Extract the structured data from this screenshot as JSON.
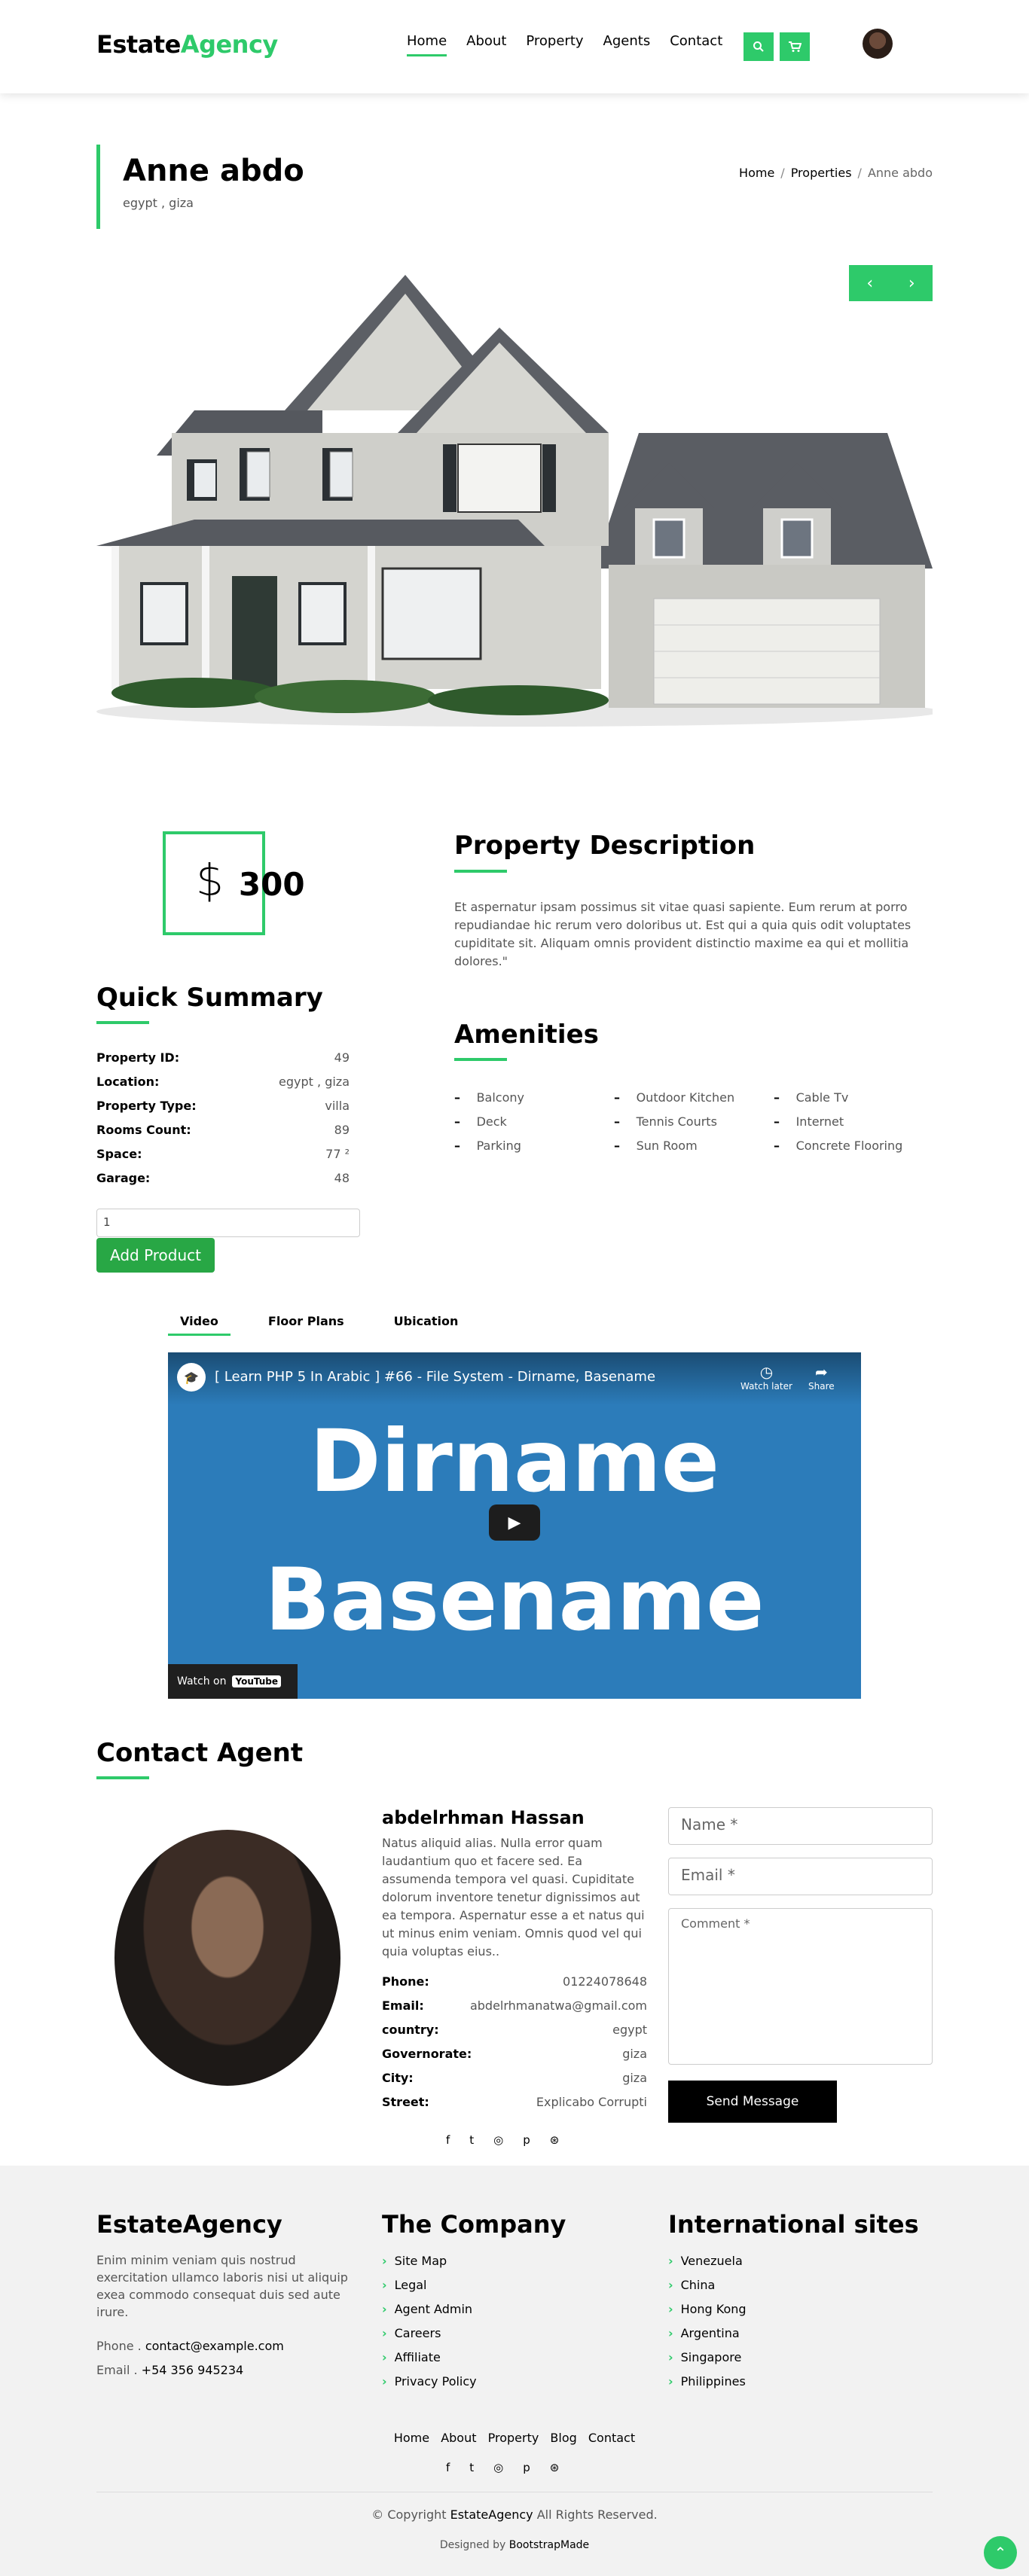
{
  "brand": {
    "part1": "Estate",
    "part2": "Agency"
  },
  "nav": {
    "links": [
      "Home",
      "About",
      "Property",
      "Agents",
      "Contact"
    ]
  },
  "header": {
    "title": "Anne abdo",
    "subtitle": "egypt , giza"
  },
  "breadcrumb": {
    "items": [
      "Home",
      "Properties",
      "Anne abdo"
    ]
  },
  "carousel": {
    "prev": "‹",
    "next": "›"
  },
  "price": {
    "currency": "$",
    "amount": "300"
  },
  "summary": {
    "title": "Quick Summary",
    "rows": [
      {
        "k": "Property ID:",
        "v": "49"
      },
      {
        "k": "Location:",
        "v": "egypt , giza"
      },
      {
        "k": "Property Type:",
        "v": "villa"
      },
      {
        "k": "Rooms Count:",
        "v": "89"
      },
      {
        "k": "Space:",
        "v": "77 ²"
      },
      {
        "k": "Garage:",
        "v": "48"
      }
    ],
    "quantity": "1",
    "add_button": "Add Product"
  },
  "description": {
    "title": "Property Description",
    "text": "Et aspernatur ipsam possimus sit vitae quasi sapiente. Eum rerum at porro repudiandae hic rerum vero doloribus ut. Est qui a quia quis odit voluptates cupiditate sit. Aliquam omnis provident distinctio maxime ea qui et mollitia dolores.\""
  },
  "amenities": {
    "title": "Amenities",
    "items": [
      "Balcony",
      "Outdoor Kitchen",
      "Cable Tv",
      "Deck",
      "Tennis Courts",
      "Internet",
      "Parking",
      "Sun Room",
      "Concrete Flooring"
    ]
  },
  "tabs": [
    "Video",
    "Floor Plans",
    "Ubication"
  ],
  "video": {
    "title": "[ Learn PHP 5 In Arabic ] #66 - File System - Dirname, Basename",
    "watch_later": "Watch later",
    "share": "Share",
    "big1": "Dirname",
    "big2": "Basename",
    "watch_on": "Watch on",
    "yt": "YouTube"
  },
  "agent": {
    "section_title": "Contact Agent",
    "name": "abdelrhman Hassan",
    "bio": "Natus aliquid alias. Nulla error quam laudantium quo et facere sed. Ea assumenda tempora vel quasi. Cupiditate dolorum inventore tenetur dignissimos aut ea tempora. Aspernatur esse a et natus qui ut minus enim veniam. Omnis quod vel qui quia voluptas eius..",
    "rows": [
      {
        "k": "Phone:",
        "v": "01224078648"
      },
      {
        "k": "Email:",
        "v": "abdelrhmanatwa@gmail.com"
      },
      {
        "k": "country:",
        "v": "egypt"
      },
      {
        "k": "Governorate:",
        "v": "giza"
      },
      {
        "k": "City:",
        "v": "giza"
      },
      {
        "k": "Street:",
        "v": "Explicabo Corrupti"
      }
    ]
  },
  "form": {
    "name": "Name *",
    "email": "Email *",
    "comment": "Comment *",
    "send": "Send Message"
  },
  "social": [
    "f",
    "t",
    "◎",
    "p",
    "⊛"
  ],
  "footer": {
    "col1": {
      "title": "EstateAgency",
      "text": "Enim minim veniam quis nostrud exercitation ullamco laboris nisi ut aliquip exea commodo consequat duis sed aute irure.",
      "phone_label": "Phone .",
      "phone": "contact@example.com",
      "email_label": "Email .",
      "email": "+54 356 945234"
    },
    "col2": {
      "title": "The Company",
      "items": [
        "Site Map",
        "Legal",
        "Agent Admin",
        "Careers",
        "Affiliate",
        "Privacy Policy"
      ]
    },
    "col3": {
      "title": "International sites",
      "items": [
        "Venezuela",
        "China",
        "Hong Kong",
        "Argentina",
        "Singapore",
        "Philippines"
      ]
    },
    "nav": [
      "Home",
      "About",
      "Property",
      "Blog",
      "Contact"
    ],
    "copy_prefix": "© Copyright",
    "copy_brand": "EstateAgency",
    "copy_suffix": "All Rights Reserved.",
    "design_prefix": "Designed by",
    "design_brand": "BootstrapMade"
  },
  "colors": {
    "accent": "#2eca6a",
    "button": "#28a745",
    "video_bg": "#2c7cba"
  }
}
